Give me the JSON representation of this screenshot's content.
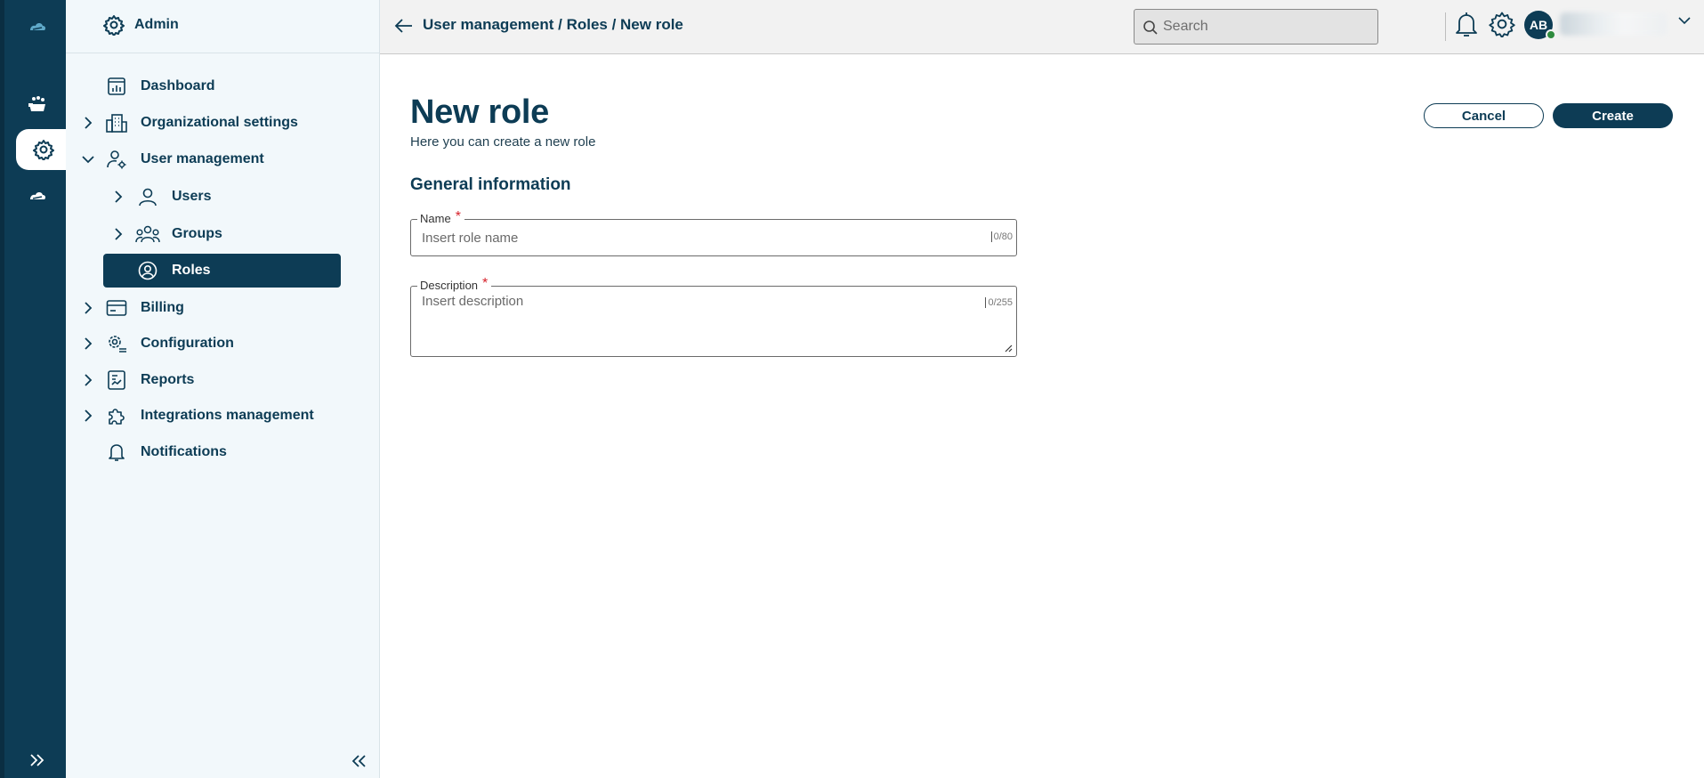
{
  "colors": {
    "primary": "#0d3c55",
    "required": "#d6222b",
    "presence": "#2e8b3e"
  },
  "rail": {
    "items": [
      {
        "name": "cloud-icon"
      },
      {
        "name": "workload-icon"
      },
      {
        "name": "settings-gear-icon",
        "active": true
      },
      {
        "name": "cloud-sync-icon"
      }
    ],
    "expand_icon": "double-chevron-right-icon"
  },
  "sidebar": {
    "title": "Admin",
    "items": [
      {
        "label": "Dashboard",
        "icon": "dashboard-icon"
      },
      {
        "label": "Organizational settings",
        "icon": "building-icon",
        "expandable": true
      },
      {
        "label": "User management",
        "icon": "user-gear-icon",
        "expanded": true
      },
      {
        "label": "Users",
        "icon": "user-icon",
        "expandable": true,
        "sub": true
      },
      {
        "label": "Groups",
        "icon": "group-icon",
        "expandable": true,
        "sub": true
      },
      {
        "label": "Roles",
        "icon": "role-icon",
        "sub": true,
        "selected": true
      },
      {
        "label": "Billing",
        "icon": "billing-card-icon",
        "expandable": true
      },
      {
        "label": "Configuration",
        "icon": "configuration-icon",
        "expandable": true
      },
      {
        "label": "Reports",
        "icon": "report-icon",
        "expandable": true
      },
      {
        "label": "Integrations management",
        "icon": "puzzle-icon",
        "expandable": true
      },
      {
        "label": "Notifications",
        "icon": "bell-icon"
      }
    ],
    "collapse_icon": "double-chevron-left-icon"
  },
  "topbar": {
    "breadcrumb": [
      "User management",
      "Roles",
      "New role"
    ],
    "separator": " / ",
    "search_placeholder": "Search",
    "avatar_initials": "AB"
  },
  "page": {
    "title": "New role",
    "subtitle": "Here you can create a new role",
    "cancel_label": "Cancel",
    "create_label": "Create",
    "section_title": "General information",
    "name_field": {
      "label": "Name",
      "required_mark": "*",
      "placeholder": "Insert role name",
      "counter": "0/80"
    },
    "description_field": {
      "label": "Description",
      "required_mark": "*",
      "placeholder": "Insert description",
      "counter": "0/255"
    }
  }
}
